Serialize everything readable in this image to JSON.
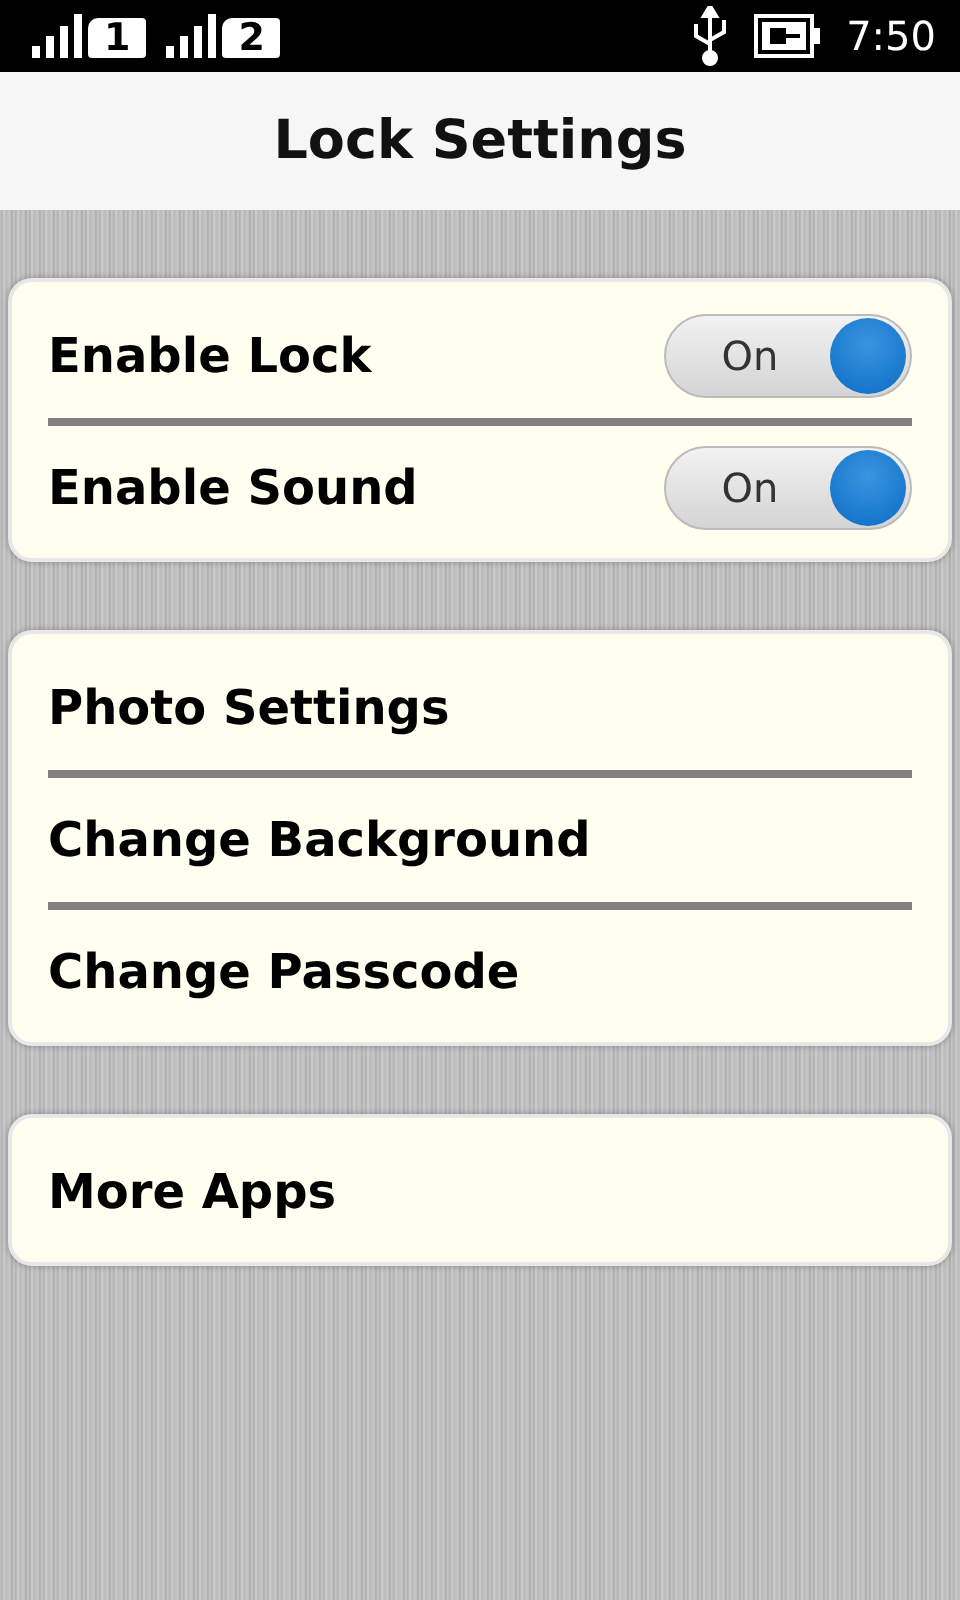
{
  "status_bar": {
    "sims": [
      {
        "label": "1"
      },
      {
        "label": "2"
      }
    ],
    "time": "7:50"
  },
  "header": {
    "title": "Lock Settings"
  },
  "groups": [
    {
      "items": [
        {
          "kind": "toggle",
          "label": "Enable Lock",
          "switch_label": "On",
          "on": true
        },
        {
          "kind": "toggle",
          "label": "Enable Sound",
          "switch_label": "On",
          "on": true
        }
      ]
    },
    {
      "items": [
        {
          "kind": "link",
          "label": "Photo Settings"
        },
        {
          "kind": "link",
          "label": "Change Background"
        },
        {
          "kind": "link",
          "label": "Change Passcode"
        }
      ]
    },
    {
      "items": [
        {
          "kind": "link",
          "label": "More Apps"
        }
      ]
    }
  ]
}
